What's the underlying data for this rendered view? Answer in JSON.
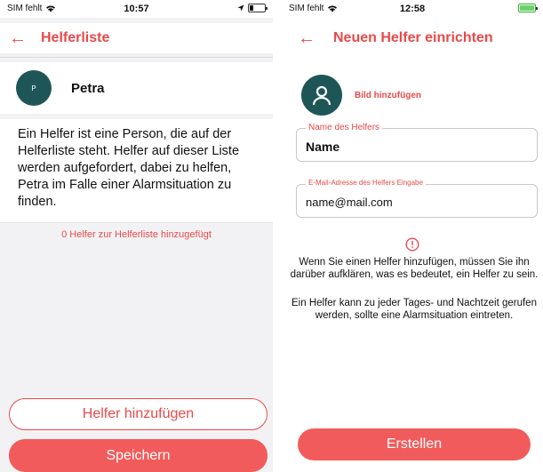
{
  "colors": {
    "accent": "#e84a4a",
    "button": "#f25b5b",
    "avatar": "#1e5658"
  },
  "left": {
    "status": {
      "carrier": "SIM fehlt",
      "time": "10:57"
    },
    "nav": {
      "back_icon": "arrow-left-icon",
      "title": "Helferliste"
    },
    "person": {
      "initial": "P",
      "name": "Petra"
    },
    "info": "Ein Helfer ist eine Person, die auf der Helferliste steht. Helfer auf dieser Liste werden aufgefordert, dabei zu helfen, Petra im Falle einer Alarmsituation zu finden.",
    "empty_note": "0 Helfer zur Helferliste hinzugefügt",
    "add_button": "Helfer hinzufügen",
    "save_button": "Speichern"
  },
  "right": {
    "status": {
      "carrier": "SIM fehlt",
      "time": "12:58"
    },
    "nav": {
      "back_icon": "arrow-left-icon",
      "title": "Neuen Helfer einrichten"
    },
    "photo": {
      "icon": "user-icon",
      "label": "Bild hinzufügen"
    },
    "name_field": {
      "label": "Name des Helfers",
      "value": "Name"
    },
    "email_field": {
      "label": "E-Mail-Adresse des Helfers Eingabe",
      "value": "name@mail.com"
    },
    "warning_icon": "alert-circle-icon",
    "warning_1": "Wenn Sie einen Helfer hinzufügen, müssen Sie ihn darüber aufklären, was es bedeutet, ein Helfer zu sein.",
    "warning_2": "Ein Helfer kann zu jeder Tages- und Nachtzeit gerufen werden, sollte eine Alarmsituation eintreten.",
    "create_button": "Erstellen"
  }
}
